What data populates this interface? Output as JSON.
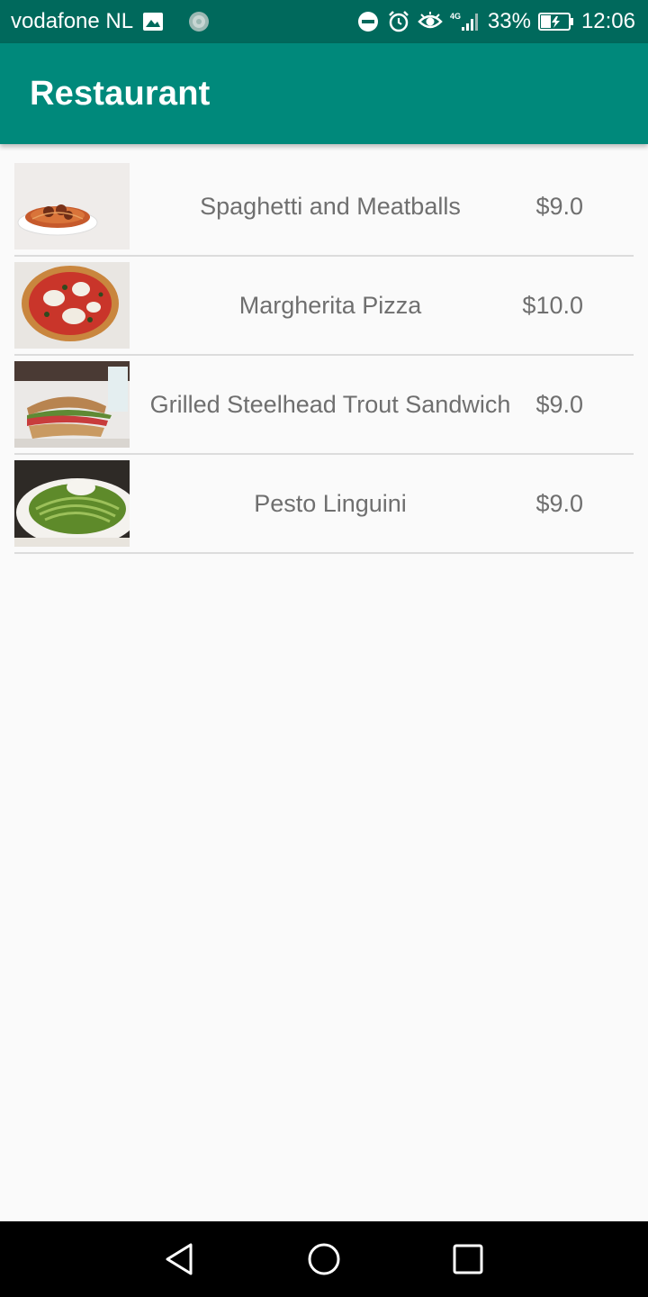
{
  "status_bar": {
    "carrier": "vodafone NL",
    "network": "4G",
    "battery": "33%",
    "time": "12:06",
    "icons": [
      "image-icon",
      "sync-icon",
      "dnd-icon",
      "alarm-icon",
      "eye-icon",
      "signal-icon",
      "battery-charging-icon"
    ]
  },
  "app_bar": {
    "title": "Restaurant",
    "color": "#00897b"
  },
  "menu": {
    "items": [
      {
        "name": "Spaghetti and Meatballs",
        "price": "$9.0",
        "image": "spaghetti-meatballs-photo"
      },
      {
        "name": "Margherita Pizza",
        "price": "$10.0",
        "image": "margherita-pizza-photo"
      },
      {
        "name": "Grilled Steelhead Trout Sandwich",
        "price": "$9.0",
        "image": "trout-sandwich-photo"
      },
      {
        "name": "Pesto Linguini",
        "price": "$9.0",
        "image": "pesto-linguini-photo"
      }
    ]
  },
  "nav_bar": {
    "buttons": [
      "back-icon",
      "home-icon",
      "recents-icon"
    ]
  }
}
